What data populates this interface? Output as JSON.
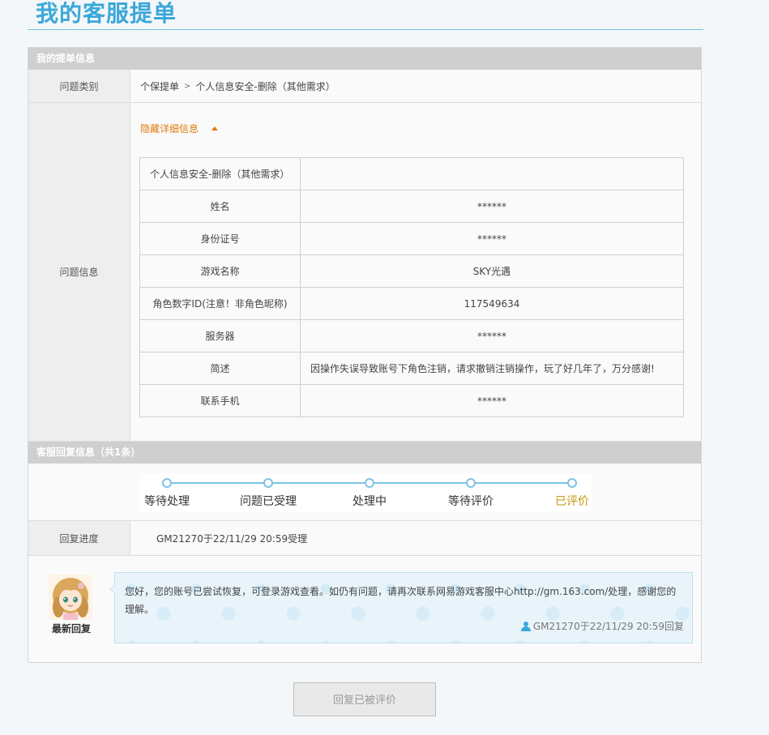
{
  "page": {
    "title": "我的客服提单"
  },
  "ticket_info": {
    "section_title": "我的提单信息",
    "category": {
      "label": "问题类别",
      "path_1": "个保提单",
      "separator": ">",
      "path_2": "个人信息安全-删除（其他需求）"
    },
    "issue": {
      "label": "问题信息",
      "toggle_label": "隐藏详细信息",
      "table_header": "个人信息安全-删除（其他需求）",
      "fields": [
        {
          "key": "姓名",
          "value": "******"
        },
        {
          "key": "身份证号",
          "value": "******"
        },
        {
          "key": "游戏名称",
          "value": "SKY光遇"
        },
        {
          "key": "角色数字ID(注意！非角色昵称)",
          "value": "117549634"
        },
        {
          "key": "服务器",
          "value": "******"
        },
        {
          "key": "简述",
          "value": "因操作失误导致账号下角色注销，请求撤销注销操作，玩了好几年了，万分感谢!"
        },
        {
          "key": "联系手机",
          "value": "******"
        }
      ]
    }
  },
  "reply_info": {
    "section_title": "客服回复信息（共1条）",
    "progress": {
      "steps": [
        "等待处理",
        "问题已受理",
        "处理中",
        "等待评价",
        "已评价"
      ],
      "current_step": "已评价",
      "accent_color": "#c8940a"
    },
    "reply_progress": {
      "label": "回复进度",
      "value": "GM21270于22/11/29 20:59受理"
    },
    "latest_reply": {
      "avatar_caption": "最新回复",
      "text": "您好，您的账号已尝试恢复，可登录游戏查看。如仍有问题，请再次联系网易游戏客服中心http://gm.163.com/处理，感谢您的理解。",
      "meta": "GM21270于22/11/29 20:59回复"
    }
  },
  "actions": {
    "submit_label": "回复已被评价"
  },
  "colors": {
    "title": "#3ba8d9",
    "link": "#e07d10",
    "section_bar": "#cfcfcf"
  }
}
